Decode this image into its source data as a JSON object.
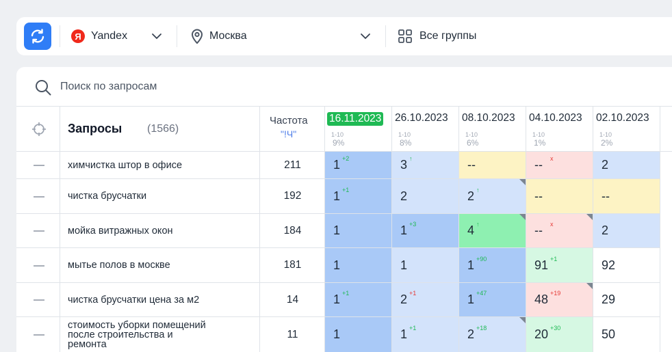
{
  "toolbar": {
    "engine": "Yandex",
    "engine_logo": "Я",
    "region": "Москва",
    "groups": "Все группы"
  },
  "search": {
    "placeholder": "Поиск по запросам"
  },
  "header": {
    "queries_title": "Запросы",
    "queries_count": "(1566)",
    "freq_title": "Частота",
    "freq_sub": "\"!Ч\"",
    "dates": [
      {
        "date": "16.11.2023",
        "range": "1-10",
        "pct": "9%",
        "current": true
      },
      {
        "date": "26.10.2023",
        "range": "1-10",
        "pct": "8%",
        "current": false
      },
      {
        "date": "08.10.2023",
        "range": "1-10",
        "pct": "6%",
        "current": false
      },
      {
        "date": "04.10.2023",
        "range": "1-10",
        "pct": "1%",
        "current": false
      },
      {
        "date": "02.10.2023",
        "range": "1-10",
        "pct": "2%",
        "current": false
      }
    ]
  },
  "rows": [
    {
      "query": "химчистка штор в офисе",
      "freq": "211",
      "cells": [
        {
          "v": "1",
          "ch": "+2",
          "color": "blue"
        },
        {
          "v": "3",
          "ch": "↑",
          "color": "lblue"
        },
        {
          "v": "--",
          "ch": "",
          "color": "yellow"
        },
        {
          "v": "--",
          "ch": "x",
          "neg": true,
          "color": "pink"
        },
        {
          "v": "2",
          "ch": "",
          "color": "lblue"
        }
      ]
    },
    {
      "query": "чистка брусчатки",
      "freq": "192",
      "cells": [
        {
          "v": "1",
          "ch": "+1",
          "color": "blue"
        },
        {
          "v": "2",
          "ch": "",
          "color": "lblue"
        },
        {
          "v": "2",
          "ch": "↑",
          "color": "lblue",
          "corner": true
        },
        {
          "v": "--",
          "ch": "",
          "color": "yellow"
        },
        {
          "v": "--",
          "ch": "",
          "color": "yellow"
        }
      ]
    },
    {
      "query": "мойка витражных окон",
      "freq": "184",
      "cells": [
        {
          "v": "1",
          "ch": "",
          "color": "blue"
        },
        {
          "v": "1",
          "ch": "+3",
          "color": "blue"
        },
        {
          "v": "4",
          "ch": "↑",
          "color": "green",
          "corner": true
        },
        {
          "v": "--",
          "ch": "x",
          "neg": true,
          "color": "pink",
          "corner": true
        },
        {
          "v": "2",
          "ch": "",
          "color": "lblue"
        }
      ]
    },
    {
      "query": "мытье полов в москве",
      "freq": "181",
      "cells": [
        {
          "v": "1",
          "ch": "",
          "color": "blue"
        },
        {
          "v": "1",
          "ch": "",
          "color": "lblue"
        },
        {
          "v": "1",
          "ch": "+90",
          "color": "blue"
        },
        {
          "v": "91",
          "ch": "+1",
          "color": "lgreen"
        },
        {
          "v": "92",
          "ch": "",
          "color": "white"
        }
      ]
    },
    {
      "query": "чистка брусчатки цена за м2",
      "freq": "14",
      "cells": [
        {
          "v": "1",
          "ch": "+1",
          "color": "blue"
        },
        {
          "v": "2",
          "ch": "+1",
          "neg": true,
          "color": "lblue"
        },
        {
          "v": "1",
          "ch": "+47",
          "color": "blue"
        },
        {
          "v": "48",
          "ch": "+19",
          "neg": true,
          "color": "pink",
          "corner": true
        },
        {
          "v": "29",
          "ch": "",
          "color": "white"
        }
      ]
    },
    {
      "query": "стоимость уборки помещений после строительства и ремонта",
      "freq": "11",
      "cells": [
        {
          "v": "1",
          "ch": "",
          "color": "blue"
        },
        {
          "v": "1",
          "ch": "+1",
          "color": "lblue"
        },
        {
          "v": "2",
          "ch": "+18",
          "color": "lblue",
          "corner": true
        },
        {
          "v": "20",
          "ch": "+30",
          "color": "lgreen"
        },
        {
          "v": "50",
          "ch": "",
          "color": "white"
        }
      ]
    }
  ]
}
